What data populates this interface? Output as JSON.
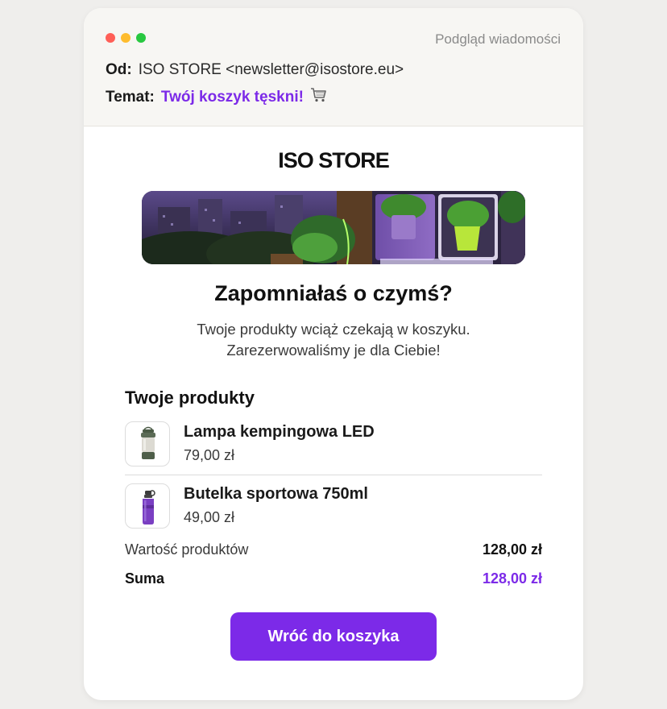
{
  "window": {
    "preview_label": "Podgląd wiadomości",
    "from_key": "Od:",
    "from_value": "ISO STORE <newsletter@isostore.eu>",
    "subject_key": "Temat:",
    "subject_value": "Twój koszyk tęskni!",
    "subject_icon": "cart-icon"
  },
  "email": {
    "brand": "ISO STORE",
    "headline": "Zapomniałaś o czymś?",
    "subtext_line1": "Twoje produkty wciąż czekają w koszyku.",
    "subtext_line2": "Zarezerwowaliśmy je dla Ciebie!",
    "section_title": "Twoje produkty",
    "products": [
      {
        "name": "Lampa kempingowa LED",
        "price": "79,00 zł",
        "icon": "lantern-icon"
      },
      {
        "name": "Butelka sportowa 750ml",
        "price": "49,00 zł",
        "icon": "bottle-icon"
      }
    ],
    "subtotal_label": "Wartość produktów",
    "subtotal_value": "128,00 zł",
    "total_label": "Suma",
    "total_value": "128,00 zł",
    "cta_label": "Wróć do koszyka"
  },
  "colors": {
    "accent": "#7c2ae8",
    "window_red": "#ff5f57",
    "window_yellow": "#febc2e",
    "window_green": "#28c840"
  }
}
